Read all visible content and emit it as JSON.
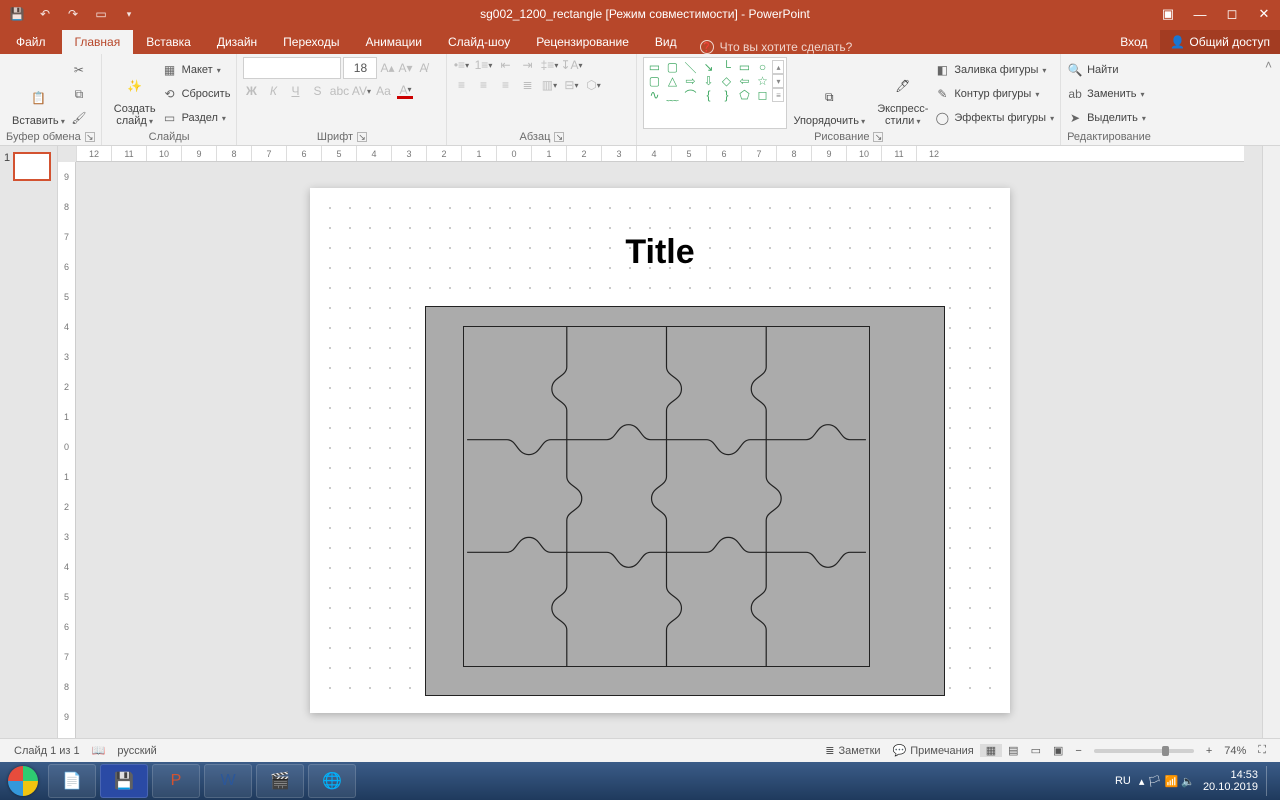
{
  "title": "sg002_1200_rectangle [Режим совместимости] - PowerPoint",
  "tabs": {
    "file": "Файл",
    "home": "Главная",
    "insert": "Вставка",
    "design": "Дизайн",
    "transitions": "Переходы",
    "animations": "Анимации",
    "slideshow": "Слайд-шоу",
    "review": "Рецензирование",
    "view": "Вид",
    "tellme": "Что вы хотите сделать?",
    "login": "Вход",
    "share": "Общий доступ"
  },
  "ribbon": {
    "clipboard": {
      "paste": "Вставить",
      "label": "Буфер обмена"
    },
    "slides": {
      "newslide": "Создать\nслайд",
      "layout": "Макет",
      "reset": "Сбросить",
      "section": "Раздел",
      "label": "Слайды"
    },
    "font": {
      "sizeValue": "18",
      "label": "Шрифт",
      "bold": "Ж",
      "italic": "К",
      "underline": "Ч",
      "strike": "S"
    },
    "para": {
      "label": "Абзац"
    },
    "drawing": {
      "arrange": "Упорядочить",
      "quick": "Экспресс-\nстили",
      "fill": "Заливка фигуры",
      "outline": "Контур фигуры",
      "effects": "Эффекты фигуры",
      "label": "Рисование"
    },
    "editing": {
      "find": "Найти",
      "replace": "Заменить",
      "select": "Выделить",
      "label": "Редактирование"
    }
  },
  "slide": {
    "title": "Title",
    "thumbIndex": "1"
  },
  "hruler": [
    "12",
    "11",
    "10",
    "9",
    "8",
    "7",
    "6",
    "5",
    "4",
    "3",
    "2",
    "1",
    "0",
    "1",
    "2",
    "3",
    "4",
    "5",
    "6",
    "7",
    "8",
    "9",
    "10",
    "11",
    "12"
  ],
  "vruler": [
    "9",
    "8",
    "7",
    "6",
    "5",
    "4",
    "3",
    "2",
    "1",
    "0",
    "1",
    "2",
    "3",
    "4",
    "5",
    "6",
    "7",
    "8",
    "9"
  ],
  "status": {
    "slide": "Слайд 1 из 1",
    "lang": "русский",
    "notes": "Заметки",
    "comments": "Примечания",
    "zoom": "74%"
  },
  "taskbar": {
    "lang": "RU",
    "time": "14:53",
    "date": "20.10.2019"
  }
}
